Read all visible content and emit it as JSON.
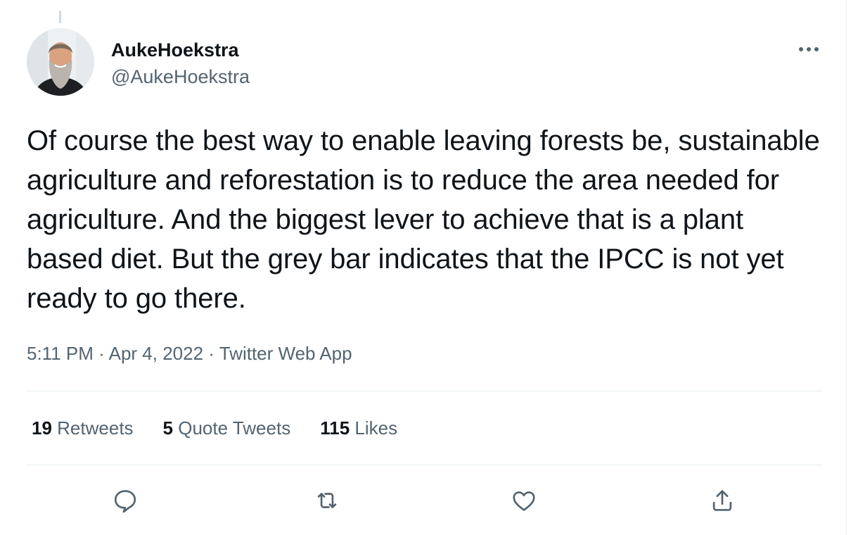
{
  "tweet": {
    "display_name": "AukeHoekstra",
    "handle": "@AukeHoekstra",
    "text": "Of course the best way to enable leaving forests be, sustainable agriculture and reforestation is to reduce the area needed for agriculture. And the biggest lever to achieve that is a plant based diet. But the grey bar indicates that the IPCC is not yet ready to go there.",
    "time": "5:11 PM",
    "separator": "·",
    "date": "Apr 4, 2022",
    "source": "Twitter Web App"
  },
  "stats": {
    "retweets_count": "19",
    "retweets_label": "Retweets",
    "quotes_count": "5",
    "quotes_label": "Quote Tweets",
    "likes_count": "115",
    "likes_label": "Likes"
  },
  "actions": {
    "reply_icon": "reply-icon",
    "retweet_icon": "retweet-icon",
    "like_icon": "heart-icon",
    "share_icon": "share-icon"
  },
  "colors": {
    "text_primary": "#0f1419",
    "text_secondary": "#536471",
    "divider": "#e6ecf0"
  }
}
